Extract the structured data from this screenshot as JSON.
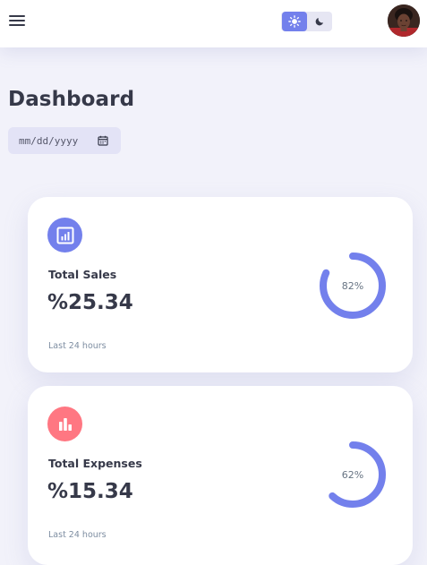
{
  "topbar": {
    "menu_icon": "hamburger-menu-icon",
    "theme_toggle": {
      "light_icon": "sun-icon",
      "dark_icon": "moon-icon",
      "active": "light"
    },
    "avatar": "profile-avatar"
  },
  "page": {
    "title": "Dashboard",
    "date_input": {
      "placeholder": "mm/dd/yyyy",
      "icon": "calendar-icon"
    }
  },
  "cards": [
    {
      "label": "Total Sales",
      "value": "%25.34",
      "footer": "Last 24 hours",
      "progress_text": "82%",
      "progress": 0.82,
      "icon": "analytics-icon",
      "icon_color": "#7380ec"
    },
    {
      "label": "Total Expenses",
      "value": "%15.34",
      "footer": "Last 24 hours",
      "progress_text": "62%",
      "progress": 0.62,
      "icon": "bar-chart-icon",
      "icon_color": "#ff7782"
    }
  ],
  "colors": {
    "primary": "#7380ec",
    "danger": "#ff7782",
    "background": "#f2f2fa",
    "text_dark": "#363949"
  }
}
